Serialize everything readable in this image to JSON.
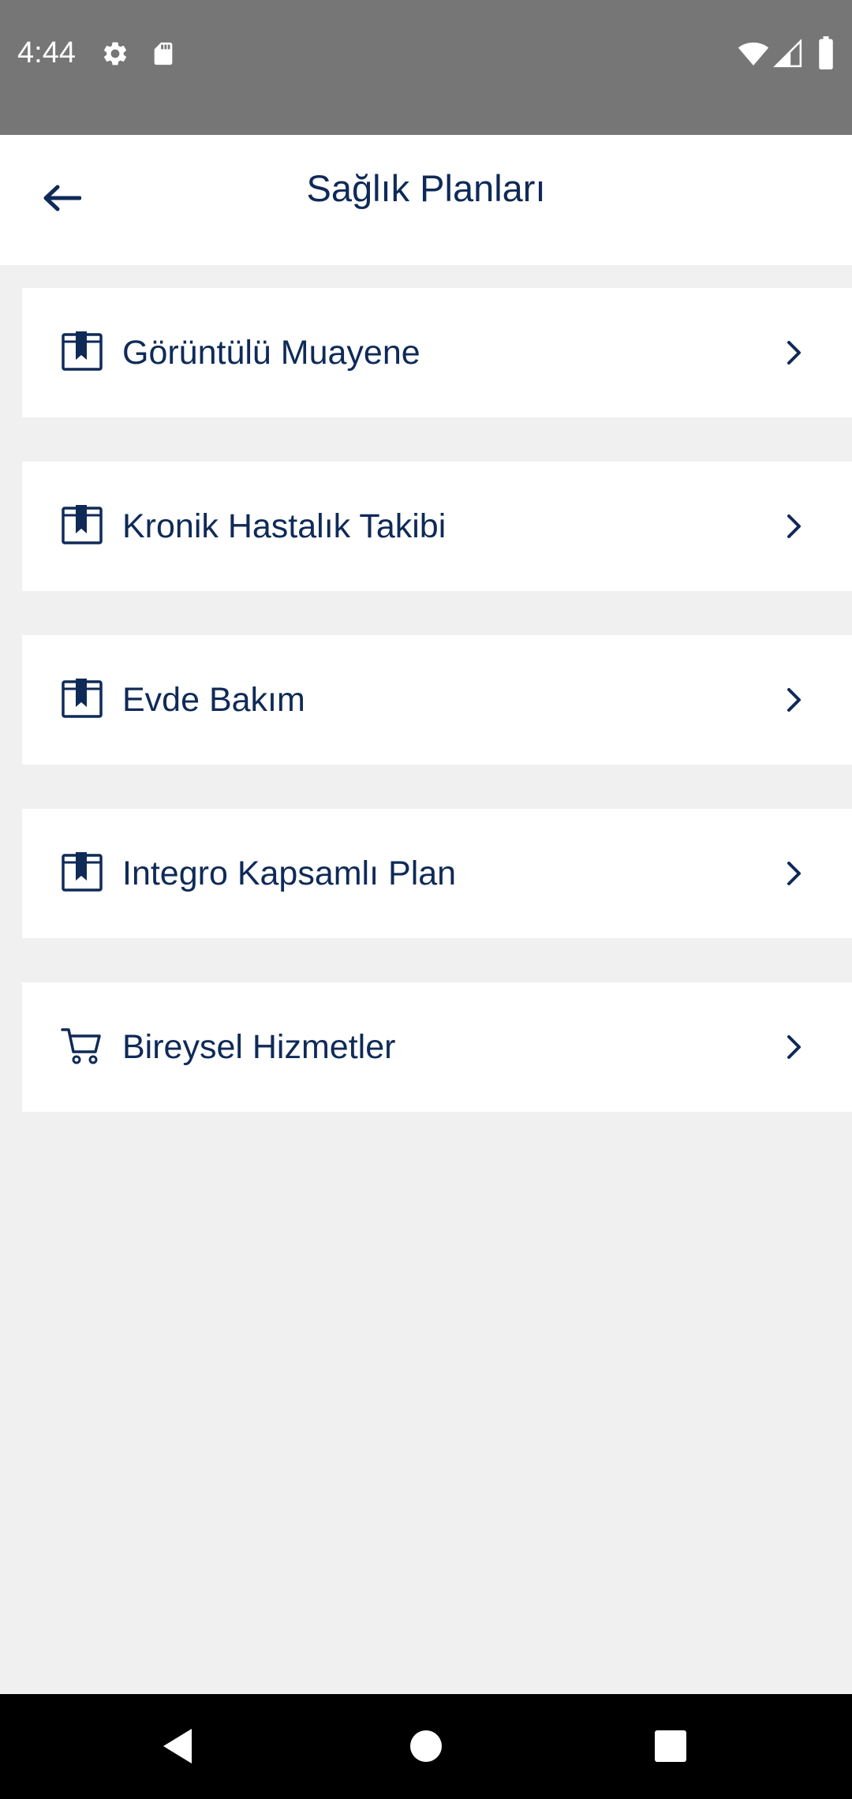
{
  "status_bar": {
    "time": "4:44",
    "icons": [
      "gear-icon",
      "sd-card-icon",
      "wifi-icon",
      "cell-signal-icon",
      "battery-icon"
    ]
  },
  "app_bar": {
    "title": "Sağlık Planları",
    "back_icon": "back-arrow-icon"
  },
  "menu": {
    "items": [
      {
        "label": "Görüntülü Muayene",
        "icon": "plan-book-icon"
      },
      {
        "label": "Kronik Hastalık Takibi",
        "icon": "plan-book-icon"
      },
      {
        "label": "Evde Bakım",
        "icon": "plan-book-icon"
      },
      {
        "label": "Integro Kapsamlı Plan",
        "icon": "plan-book-icon"
      },
      {
        "label": "Bireysel Hizmetler",
        "icon": "shopping-cart-icon"
      }
    ]
  },
  "nav_bar": {
    "icons": [
      "nav-back-icon",
      "nav-home-icon",
      "nav-recents-icon"
    ]
  },
  "colors": {
    "status_bar_bg": "#767676",
    "app_bar_bg": "#ffffff",
    "page_bg": "#f0f0f0",
    "brand_text": "#0f2a57",
    "nav_bar_bg": "#000000"
  }
}
